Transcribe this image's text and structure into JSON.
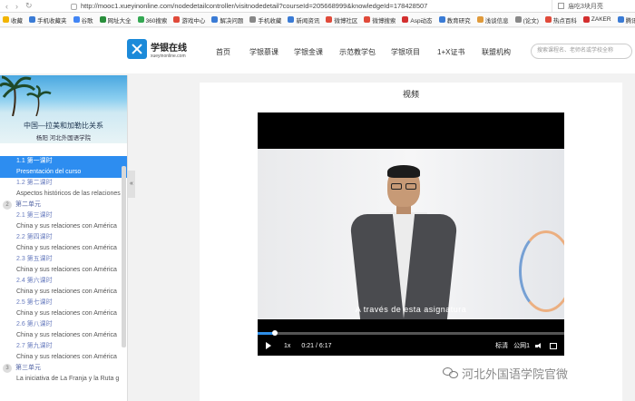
{
  "browser": {
    "url": "http://mooc1.xueyinonline.com/nodedetailcontroller/visitnodedetail?courseId=205668999&knowledgeId=178428507",
    "right_text": "庙吃3块月亮"
  },
  "bookmarks": [
    {
      "label": "收藏",
      "color": "#f2b400"
    },
    {
      "label": "手机收藏夹",
      "color": "#3a7bd5"
    },
    {
      "label": "谷歌",
      "color": "#4285f4"
    },
    {
      "label": "网址大全",
      "color": "#2a8f3c"
    },
    {
      "label": "360搜索",
      "color": "#34a853"
    },
    {
      "label": "游戏中心",
      "color": "#e04a3a"
    },
    {
      "label": "解决问题",
      "color": "#3a7bd5"
    },
    {
      "label": "手机收藏",
      "color": "#888888"
    },
    {
      "label": "新闻资讯",
      "color": "#3a7bd5"
    },
    {
      "label": "微博社区",
      "color": "#e04a3a"
    },
    {
      "label": "微博搜索",
      "color": "#e04a3a"
    },
    {
      "label": "Asp动态",
      "color": "#d32f2f"
    },
    {
      "label": "教育研究",
      "color": "#3a7bd5"
    },
    {
      "label": "浅谈信息",
      "color": "#e09a3a"
    },
    {
      "label": "(论文)",
      "color": "#888888"
    },
    {
      "label": "热点百科",
      "color": "#e04a3a"
    },
    {
      "label": "ZAKER",
      "color": "#d32f2f"
    },
    {
      "label": "腾讯企业",
      "color": "#3a7bd5"
    }
  ],
  "site": {
    "logo_cn": "学银在线",
    "logo_en": "xueyinonline.com",
    "nav": [
      "首页",
      "学银慕课",
      "学银金课",
      "示范教学包",
      "学银项目",
      "1+X证书",
      "联盟机构"
    ],
    "search_placeholder": "搜索课程名、老师名或学校全称"
  },
  "course": {
    "title": "中国—拉美和加勒比关系",
    "subtitle": "杨阳 河北外国语学院",
    "toc": [
      {
        "kind": "sub",
        "label": "1.1 第一课时",
        "active": true
      },
      {
        "kind": "text",
        "label": "Presentación del curso",
        "active": true
      },
      {
        "kind": "sub",
        "label": "1.2 第二课时"
      },
      {
        "kind": "text",
        "label": "Aspectos históricos de las relaciones"
      },
      {
        "kind": "chapter",
        "label": "第二单元",
        "num": "2"
      },
      {
        "kind": "sub",
        "label": "2.1 第三课时"
      },
      {
        "kind": "text",
        "label": "China y sus relaciones con América"
      },
      {
        "kind": "sub",
        "label": "2.2 第四课时"
      },
      {
        "kind": "text",
        "label": "China y sus relaciones con América"
      },
      {
        "kind": "sub",
        "label": "2.3 第五课时"
      },
      {
        "kind": "text",
        "label": "China y sus relaciones con América"
      },
      {
        "kind": "sub",
        "label": "2.4 第六课时"
      },
      {
        "kind": "text",
        "label": "China y sus relaciones con América"
      },
      {
        "kind": "sub",
        "label": "2.5 第七课时"
      },
      {
        "kind": "text",
        "label": "China y sus relaciones con América"
      },
      {
        "kind": "sub",
        "label": "2.6 第八课时"
      },
      {
        "kind": "text",
        "label": "China y sus relaciones con América"
      },
      {
        "kind": "sub",
        "label": "2.7 第九课时"
      },
      {
        "kind": "text",
        "label": "China y sus relaciones con América"
      },
      {
        "kind": "chapter",
        "label": "第三单元",
        "num": "3"
      },
      {
        "kind": "text",
        "label": "La iniciativa de La Franja y la Ruta g"
      }
    ],
    "collapse_glyph": "«"
  },
  "video": {
    "heading": "视频",
    "caption": "A través de esta asignatura",
    "speed": "1x",
    "time": "0:21 / 6:17",
    "progress_fraction": 0.056,
    "subtitles_label": "标清",
    "line_label": "公网1"
  },
  "watermark": {
    "text": "河北外国语学院官微"
  }
}
